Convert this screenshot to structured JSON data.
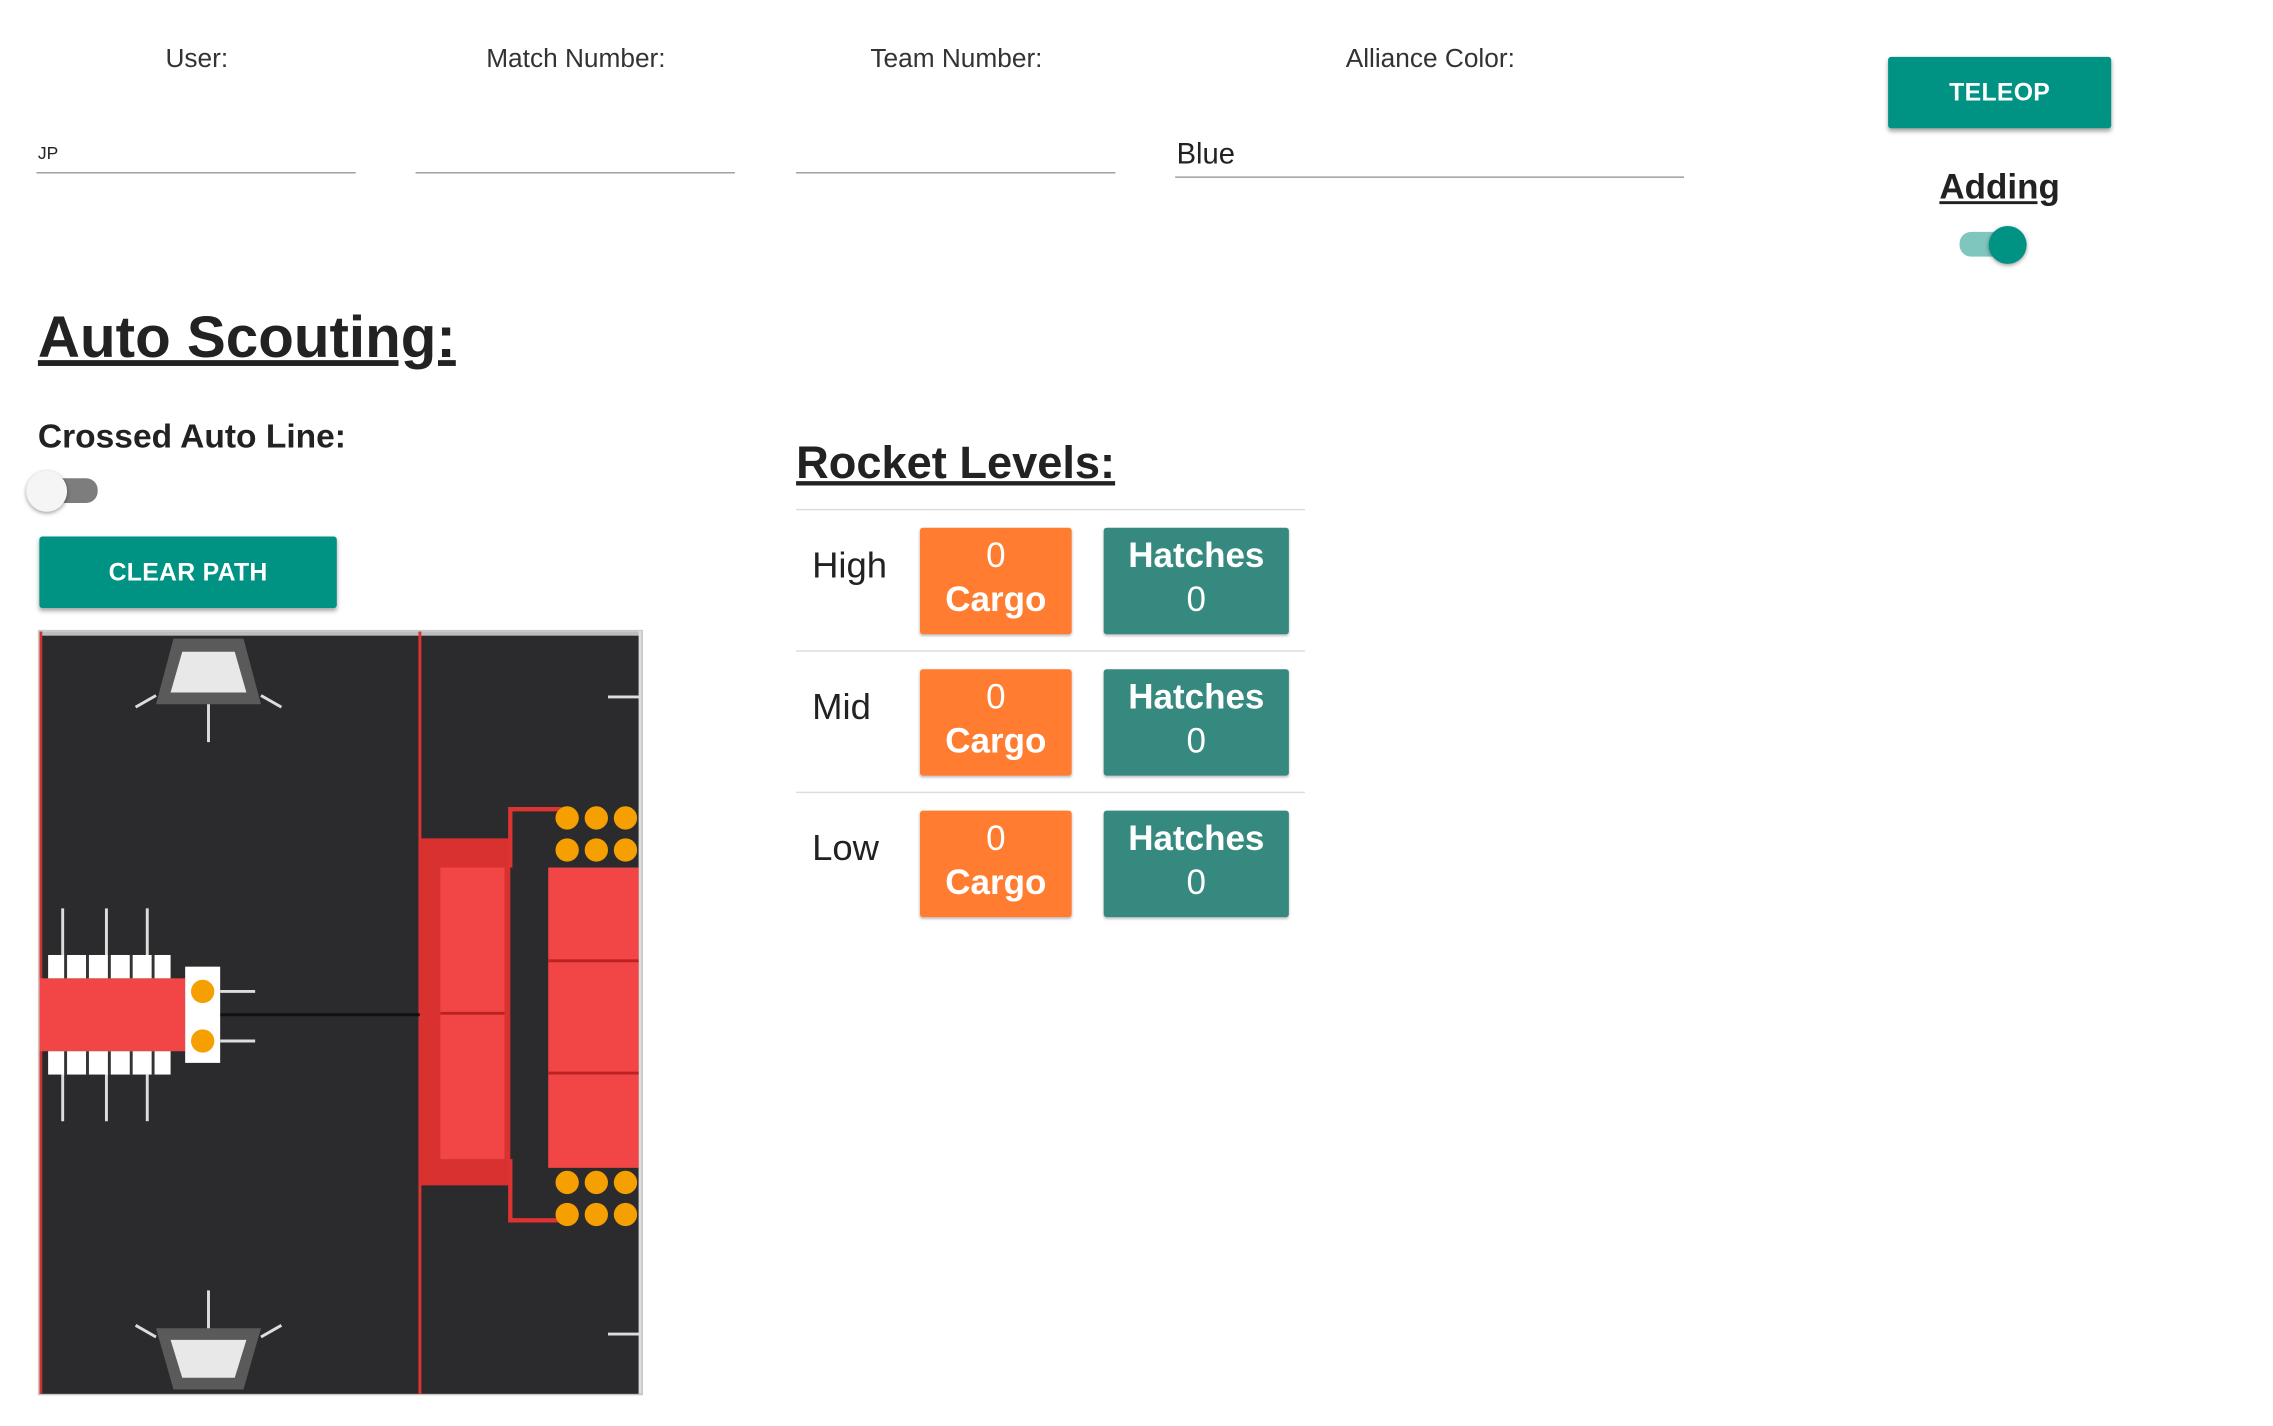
{
  "header": {
    "user": {
      "label": "User:",
      "value": "JP"
    },
    "match": {
      "label": "Match Number:",
      "value": ""
    },
    "team": {
      "label": "Team Number:",
      "value": ""
    },
    "alliance": {
      "label": "Alliance Color:",
      "value": "Blue"
    },
    "mode_button": "TELEOP",
    "adding": {
      "label": "Adding",
      "on": true
    }
  },
  "auto": {
    "title": "Auto Scouting:",
    "crossed_label": "Crossed Auto Line:",
    "crossed_on": false,
    "clear_path": "CLEAR PATH"
  },
  "rocket": {
    "title": "Rocket Levels:",
    "levels": [
      {
        "name": "High",
        "cargo_count": "0",
        "cargo_label": "Cargo",
        "hatch_label": "Hatches",
        "hatch_count": "0"
      },
      {
        "name": "Mid",
        "cargo_count": "0",
        "cargo_label": "Cargo",
        "hatch_label": "Hatches",
        "hatch_count": "0"
      },
      {
        "name": "Low",
        "cargo_count": "0",
        "cargo_label": "Cargo",
        "hatch_label": "Hatches",
        "hatch_count": "0"
      }
    ]
  },
  "colors": {
    "accent": "#009383",
    "cargo": "#ff7c30",
    "hatch": "#36897e",
    "field": "#2b2b2d",
    "field_red": "#f23b3b"
  }
}
